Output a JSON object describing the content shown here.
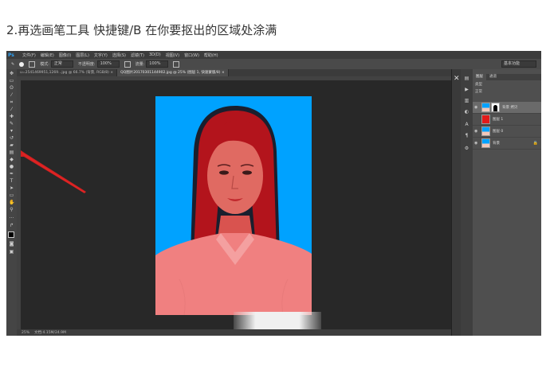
{
  "caption": "2.再选画笔工具 快捷键/B 在你要抠出的区域处涂满",
  "app": {
    "logo": "Ps",
    "menu": [
      "文件(F)",
      "编辑(E)",
      "图像(I)",
      "图层(L)",
      "文字(Y)",
      "选择(S)",
      "滤镜(T)",
      "3D(D)",
      "视图(V)",
      "窗口(W)",
      "帮助(H)"
    ]
  },
  "options_bar": {
    "mode_label": "模式:",
    "mode_value": "正常",
    "opacity_label": "不透明度:",
    "opacity_value": "100%",
    "flow_label": "流量:",
    "flow_value": "100%",
    "search_placeholder": "基本功能"
  },
  "tabs": [
    {
      "label": "u=2541469951,1269...jpg @ 66.7% (背景, RGB/8) ×",
      "active": false
    },
    {
      "label": "QQ图片20170301144902.jpg @ 25% (图层 1, 快速蒙版/8) ×",
      "active": true
    }
  ],
  "status": {
    "zoom": "25%",
    "doc": "文档:4.15M/24.9M"
  },
  "layers_panel": {
    "tabs": [
      "图层",
      "通道"
    ],
    "kind_label": "类型",
    "blend_mode": "正常",
    "opacity_label": "不透明度: 100%",
    "lock_label": "锁定:",
    "fill_label": "填充: 100%",
    "layers": [
      {
        "name": "背景 拷贝",
        "type": "photo-mask",
        "selected": true
      },
      {
        "name": "图层 1",
        "type": "red",
        "selected": false
      },
      {
        "name": "图层 0",
        "type": "photo",
        "selected": false
      },
      {
        "name": "背景",
        "type": "photo",
        "selected": false,
        "locked": true
      }
    ]
  },
  "colors": {
    "background_blue": "#00a2ff",
    "quick_mask_red": "#e21a1a",
    "ps_logo_blue": "#2fa3f7"
  },
  "icons": [
    "move-icon",
    "marquee-icon",
    "lasso-icon",
    "quick-select-icon",
    "crop-icon",
    "eyedropper-icon",
    "healing-icon",
    "brush-icon",
    "stamp-icon",
    "history-brush-icon",
    "eraser-icon",
    "gradient-icon",
    "blur-icon",
    "dodge-icon",
    "pen-icon",
    "type-icon",
    "path-select-icon",
    "shape-icon",
    "hand-icon",
    "zoom-icon",
    "close-icon"
  ]
}
